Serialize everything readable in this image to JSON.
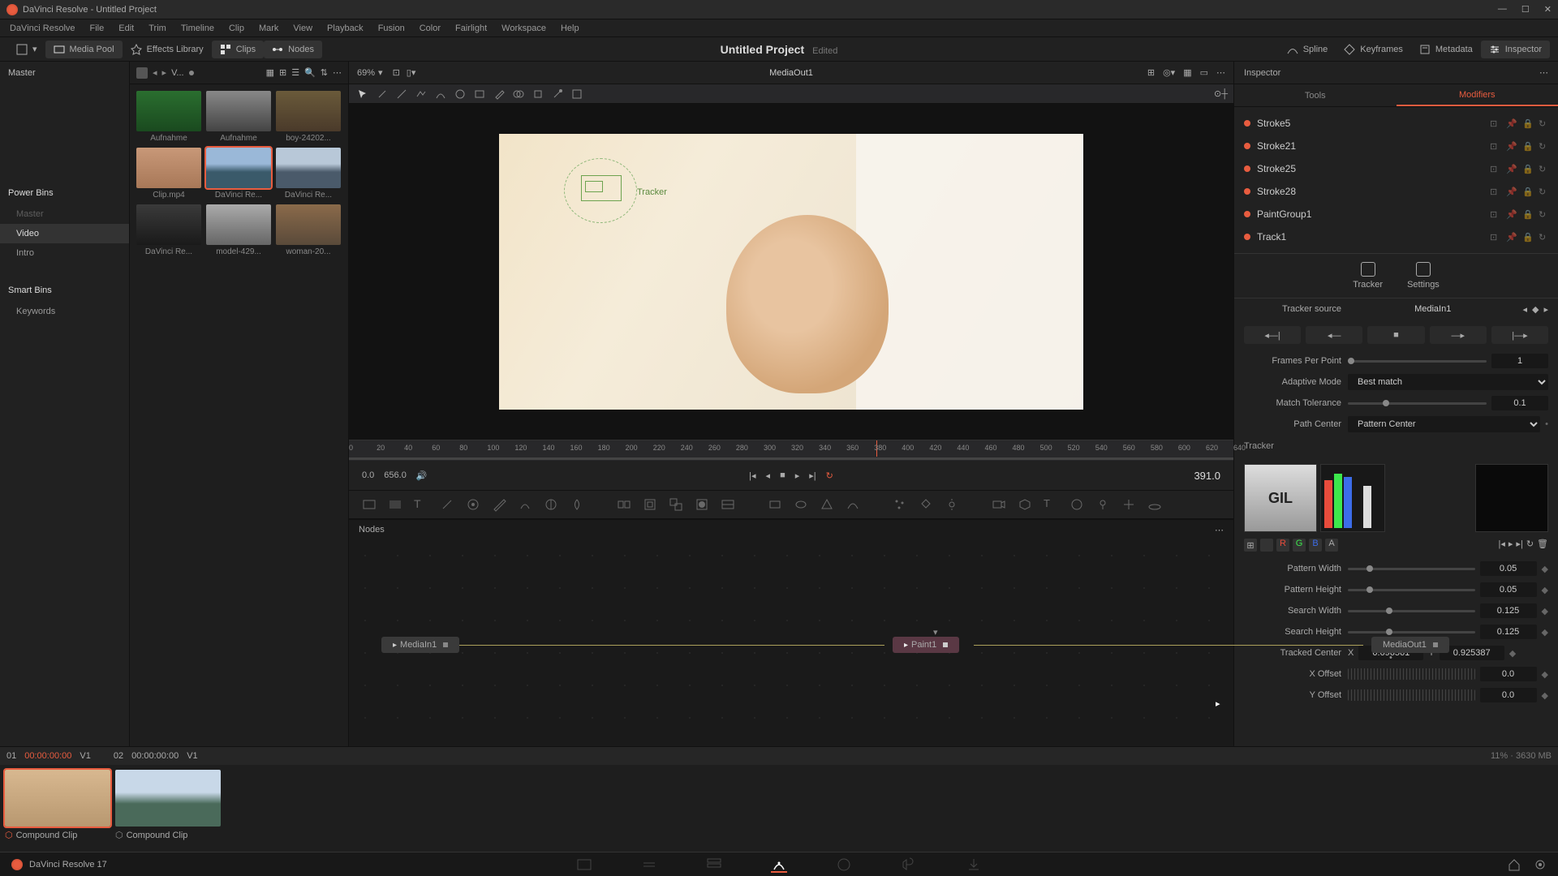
{
  "title_bar": {
    "app": "DaVinci Resolve",
    "project": "Untitled Project"
  },
  "menu": [
    "DaVinci Resolve",
    "File",
    "Edit",
    "Trim",
    "Timeline",
    "Clip",
    "Mark",
    "View",
    "Playback",
    "Fusion",
    "Color",
    "Fairlight",
    "Workspace",
    "Help"
  ],
  "toolbar": {
    "media_pool": "Media Pool",
    "effects": "Effects Library",
    "clips": "Clips",
    "nodes": "Nodes",
    "project_title": "Untitled Project",
    "edited": "Edited",
    "spline": "Spline",
    "keyframes": "Keyframes",
    "metadata": "Metadata",
    "inspector": "Inspector"
  },
  "sidebar": {
    "master": "Master",
    "power_bins": "Power Bins",
    "master2": "Master",
    "video": "Video",
    "intro": "Intro",
    "smart_bins": "Smart Bins",
    "keywords": "Keywords"
  },
  "media_header": {
    "v": "V...",
    "zoom": "69%"
  },
  "thumbs": [
    {
      "label": "Aufnahme"
    },
    {
      "label": "Aufnahme"
    },
    {
      "label": "boy-24202..."
    },
    {
      "label": "Clip.mp4"
    },
    {
      "label": "DaVinci Re...",
      "selected": true
    },
    {
      "label": "DaVinci Re..."
    },
    {
      "label": "DaVinci Re..."
    },
    {
      "label": "model-429..."
    },
    {
      "label": "woman-20..."
    }
  ],
  "viewer": {
    "label": "MediaOut1",
    "tracker_label": "Tracker"
  },
  "ruler": {
    "ticks": [
      0,
      20,
      40,
      60,
      80,
      100,
      120,
      140,
      160,
      180,
      200,
      220,
      240,
      260,
      280,
      300,
      320,
      340,
      360,
      380,
      400,
      420,
      440,
      460,
      480,
      500,
      520,
      540,
      560,
      580,
      600,
      620,
      640
    ],
    "playhead": 391
  },
  "transport": {
    "start": "0.0",
    "end": "656.0",
    "current": "391.0"
  },
  "nodes": {
    "title": "Nodes",
    "n1": "MediaIn1",
    "n2": "Paint1",
    "n3": "MediaOut1"
  },
  "clips": {
    "c01": "01",
    "tc01": "00:00:00:00",
    "v1": "V1",
    "c02": "02",
    "tc02": "00:00:00:00",
    "label": "Compound Clip"
  },
  "inspector": {
    "title": "Inspector",
    "tab_tools": "Tools",
    "tab_mods": "Modifiers",
    "mods": [
      "Stroke5",
      "Stroke21",
      "Stroke25",
      "Stroke28",
      "PaintGroup1",
      "Track1"
    ],
    "subtab_tracker": "Tracker",
    "subtab_settings": "Settings",
    "tracker_source_label": "Tracker source",
    "tracker_source": "MediaIn1",
    "frames_per_point_label": "Frames Per Point",
    "frames_per_point": "1",
    "adaptive_mode_label": "Adaptive Mode",
    "adaptive_mode": "Best match",
    "match_tolerance_label": "Match Tolerance",
    "match_tolerance": "0.1",
    "path_center_label": "Path Center",
    "path_center": "Pattern Center",
    "tracker_section": "Tracker",
    "pattern_width_label": "Pattern Width",
    "pattern_width": "0.05",
    "pattern_height_label": "Pattern Height",
    "pattern_height": "0.05",
    "search_width_label": "Search Width",
    "search_width": "0.125",
    "search_height_label": "Search Height",
    "search_height": "0.125",
    "tracked_center_label": "Tracked Center",
    "tracked_x_label": "X",
    "tracked_x": "0.096561",
    "tracked_y_label": "Y",
    "tracked_y": "0.925387",
    "x_offset_label": "X Offset",
    "x_offset": "0.0",
    "y_offset_label": "Y Offset",
    "y_offset": "0.0"
  },
  "footer": {
    "app": "DaVinci Resolve 17",
    "stats": "11% · 3630 MB"
  }
}
